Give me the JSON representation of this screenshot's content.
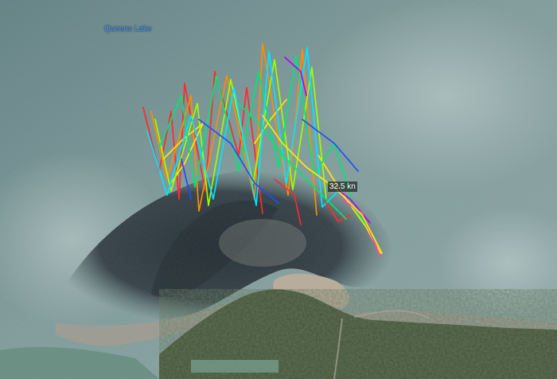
{
  "map": {
    "place_label": "Queens Lake",
    "speed_marker": "32.5 kn"
  },
  "colors": {
    "water_deep": "#4f6e72",
    "water_shallow": "#9ab5b2",
    "dark_shallows": "#2b353c",
    "sandbar": "#b8ab98",
    "forest": "#3c4c2e",
    "track_palette": [
      "#ff2a2a",
      "#ff8c00",
      "#ffe600",
      "#9cff00",
      "#00e676",
      "#00e5ff",
      "#1e4dff",
      "#b400ff",
      "#ff40c0"
    ]
  },
  "icons": [
    "track-segment",
    "speed-marker"
  ]
}
